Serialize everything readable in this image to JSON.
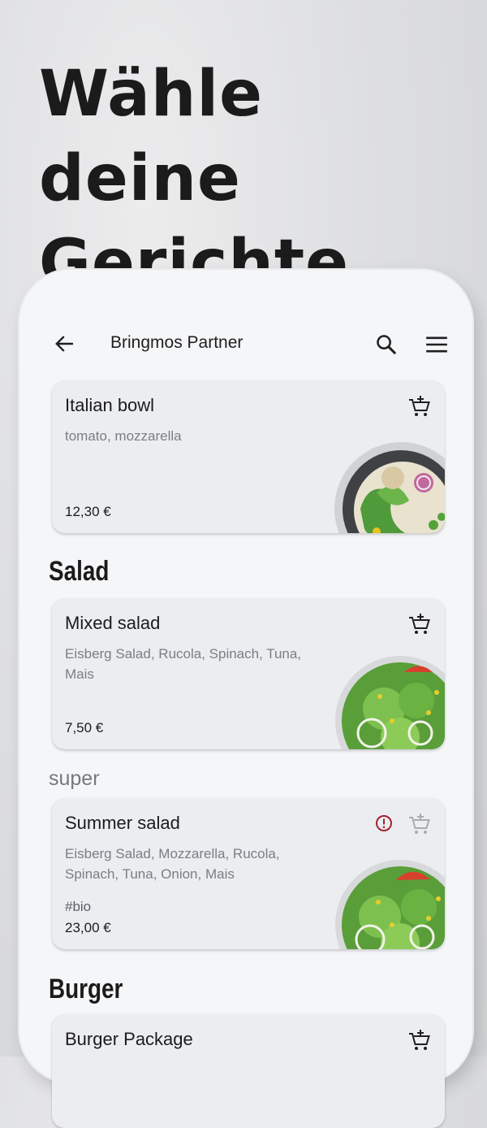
{
  "headline": "Wähle deine Gerichte",
  "app": {
    "title": "Bringmos Partner",
    "icons": {
      "back": "arrow-left-icon",
      "search": "search-icon",
      "menu": "hamburger-menu-icon"
    }
  },
  "colors": {
    "warning": "#a3222f",
    "text": "#1c1c1c",
    "muted": "#7b7e83"
  },
  "items": [
    {
      "name": "Italian bowl",
      "desc": "tomato, mozzarella",
      "price": "12,30 €"
    },
    {
      "name": "Mixed salad",
      "desc": "Eisberg Salad, Rucola, Spinach, Tuna, Mais",
      "price": "7,50 €"
    },
    {
      "name": "Summer salad",
      "desc": "Eisberg Salad, Mozzarella, Rucola, Spinach, Tuna, Onion, Mais",
      "tag": "#bio",
      "price": "23,00 €"
    },
    {
      "name": "Burger Package"
    }
  ],
  "sections": {
    "salad": "Salad",
    "super": "super",
    "burger": "Burger"
  }
}
